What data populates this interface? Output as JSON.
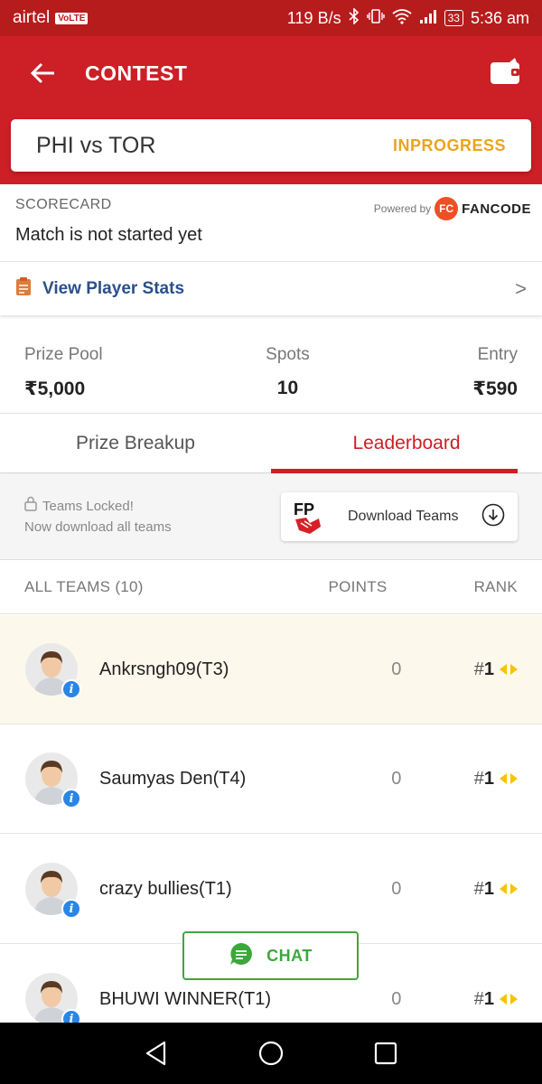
{
  "statusbar": {
    "carrier": "airtel",
    "volte": "VoLTE",
    "speed": "119 B/s",
    "battery": "33",
    "time": "5:36 am"
  },
  "appbar": {
    "title": "CONTEST"
  },
  "match": {
    "teams": "PHI vs TOR",
    "status": "INPROGRESS"
  },
  "scorecard": {
    "label": "SCORECARD",
    "message": "Match is not started yet",
    "powered_by": "Powered by",
    "brand": "FANCODE",
    "brand_logo": "FC"
  },
  "player_stats": {
    "label": "View Player Stats",
    "chevron": ">"
  },
  "pool": {
    "prize_pool_label": "Prize Pool",
    "prize_pool_value": "₹5,000",
    "spots_label": "Spots",
    "spots_value": "10",
    "entry_label": "Entry",
    "entry_value": "₹590"
  },
  "tabs": [
    {
      "label": "Prize Breakup",
      "active": false
    },
    {
      "label": "Leaderboard",
      "active": true
    }
  ],
  "locked": {
    "line1": "Teams Locked!",
    "line2": "Now download all teams",
    "download_label": "Download Teams",
    "fp_logo": "FP"
  },
  "table": {
    "col_teams": "ALL TEAMS (10)",
    "col_points": "POINTS",
    "col_rank": "RANK",
    "rows": [
      {
        "name": "Ankrsngh09(T3)",
        "points": "0",
        "rank": "1",
        "hash": "#",
        "highlight": true
      },
      {
        "name": "Saumyas Den(T4)",
        "points": "0",
        "rank": "1",
        "hash": "#"
      },
      {
        "name": "crazy bullies(T1)",
        "points": "0",
        "rank": "1",
        "hash": "#"
      },
      {
        "name": "BHUWI WINNER(T1)",
        "points": "0",
        "rank": "1",
        "hash": "#"
      }
    ]
  },
  "chat": {
    "label": "CHAT"
  },
  "colors": {
    "primary": "#cc1f26",
    "status_orange": "#e8a520",
    "link_blue": "#2b4f8a",
    "chat_green": "#3ca83c",
    "rank_yellow": "#f5c400"
  }
}
